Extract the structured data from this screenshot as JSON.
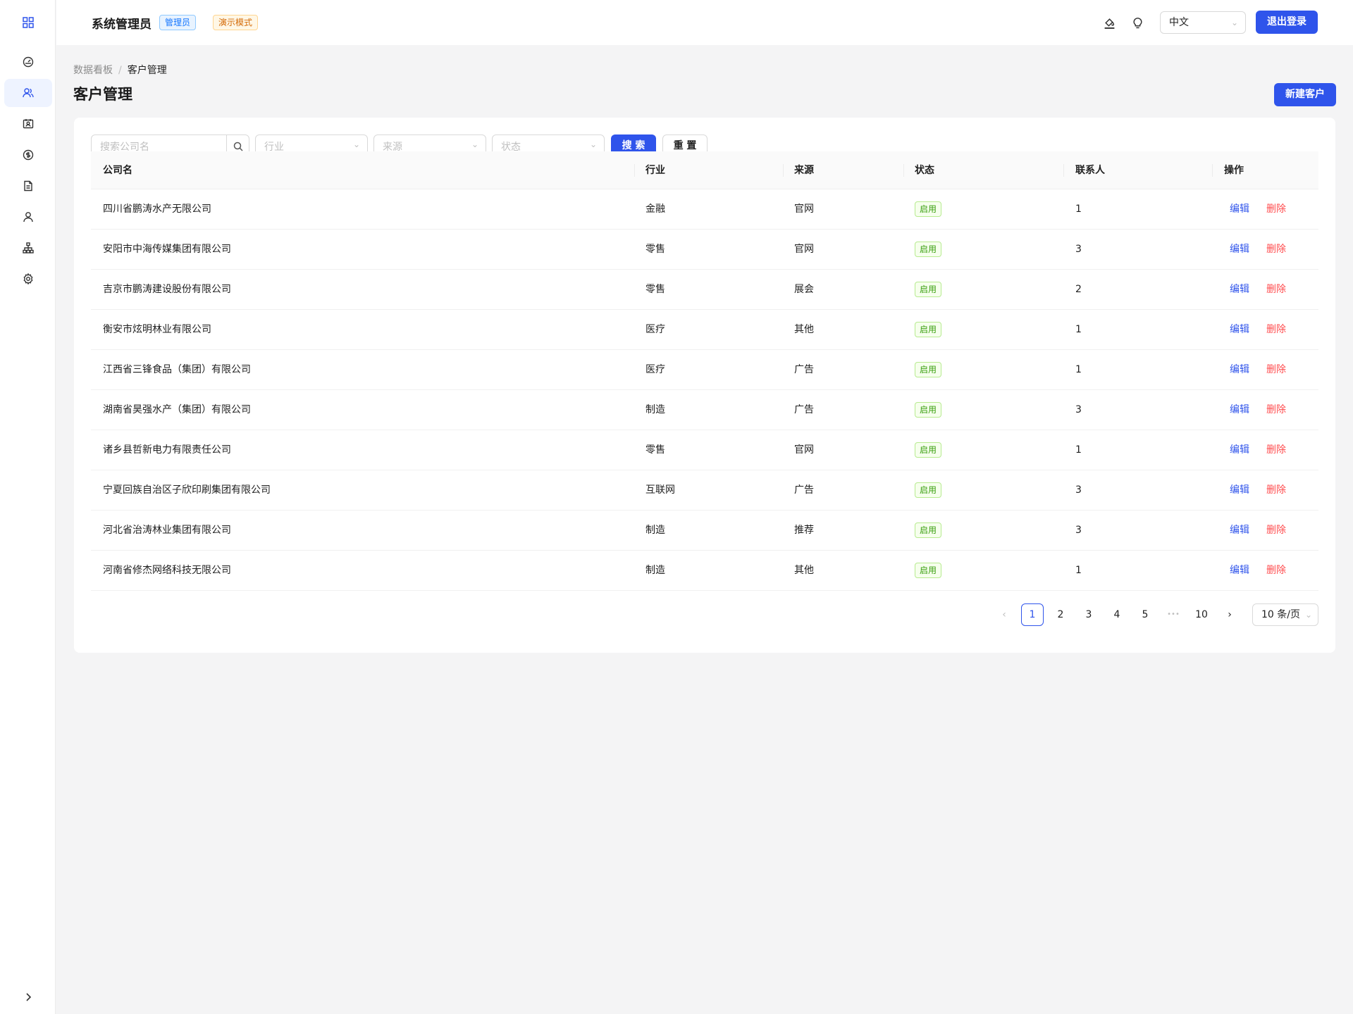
{
  "header": {
    "title": "系统管理员",
    "role_tag": "管理员",
    "mode_tag": "演示模式",
    "language": "中文",
    "logout_label": "退出登录"
  },
  "sidebar": {
    "items": [
      {
        "icon": "dashboard-icon"
      },
      {
        "icon": "customers-icon",
        "active": true
      },
      {
        "icon": "contacts-icon"
      },
      {
        "icon": "finance-icon"
      },
      {
        "icon": "document-icon"
      },
      {
        "icon": "user-icon"
      },
      {
        "icon": "organization-icon"
      },
      {
        "icon": "settings-icon"
      }
    ]
  },
  "breadcrumb": {
    "items": [
      "数据看板",
      "客户管理"
    ],
    "separator": "/"
  },
  "page": {
    "title": "客户管理",
    "new_button": "新建客户"
  },
  "filters": {
    "search_placeholder": "搜索公司名",
    "industry_placeholder": "行业",
    "source_placeholder": "来源",
    "status_placeholder": "状态",
    "search_label": "搜 索",
    "reset_label": "重 置"
  },
  "table": {
    "columns": [
      "公司名",
      "行业",
      "来源",
      "状态",
      "联系人",
      "操作"
    ],
    "edit_label": "编辑",
    "delete_label": "删除",
    "rows": [
      {
        "company": "四川省鹏涛水产无限公司",
        "industry": "金融",
        "source": "官网",
        "status": "启用",
        "contacts": "1"
      },
      {
        "company": "安阳市中海传媒集团有限公司",
        "industry": "零售",
        "source": "官网",
        "status": "启用",
        "contacts": "3"
      },
      {
        "company": "吉京市鹏涛建设股份有限公司",
        "industry": "零售",
        "source": "展会",
        "status": "启用",
        "contacts": "2"
      },
      {
        "company": "衡安市炫明林业有限公司",
        "industry": "医疗",
        "source": "其他",
        "status": "启用",
        "contacts": "1"
      },
      {
        "company": "江西省三锋食品（集团）有限公司",
        "industry": "医疗",
        "source": "广告",
        "status": "启用",
        "contacts": "1"
      },
      {
        "company": "湖南省昊强水产（集团）有限公司",
        "industry": "制造",
        "source": "广告",
        "status": "启用",
        "contacts": "3"
      },
      {
        "company": "诸乡县哲新电力有限责任公司",
        "industry": "零售",
        "source": "官网",
        "status": "启用",
        "contacts": "1"
      },
      {
        "company": "宁夏回族自治区子欣印刷集团有限公司",
        "industry": "互联网",
        "source": "广告",
        "status": "启用",
        "contacts": "3"
      },
      {
        "company": "河北省治涛林业集团有限公司",
        "industry": "制造",
        "source": "推荐",
        "status": "启用",
        "contacts": "3"
      },
      {
        "company": "河南省修杰网络科技无限公司",
        "industry": "制造",
        "source": "其他",
        "status": "启用",
        "contacts": "1"
      }
    ]
  },
  "pagination": {
    "pages": [
      "1",
      "2",
      "3",
      "4",
      "5",
      "10"
    ],
    "current": "1",
    "ellipsis": "•••",
    "page_size": "10 条/页"
  },
  "colors": {
    "primary": "#2f54eb",
    "danger": "#ff4d4f",
    "success": "#389e0d"
  }
}
